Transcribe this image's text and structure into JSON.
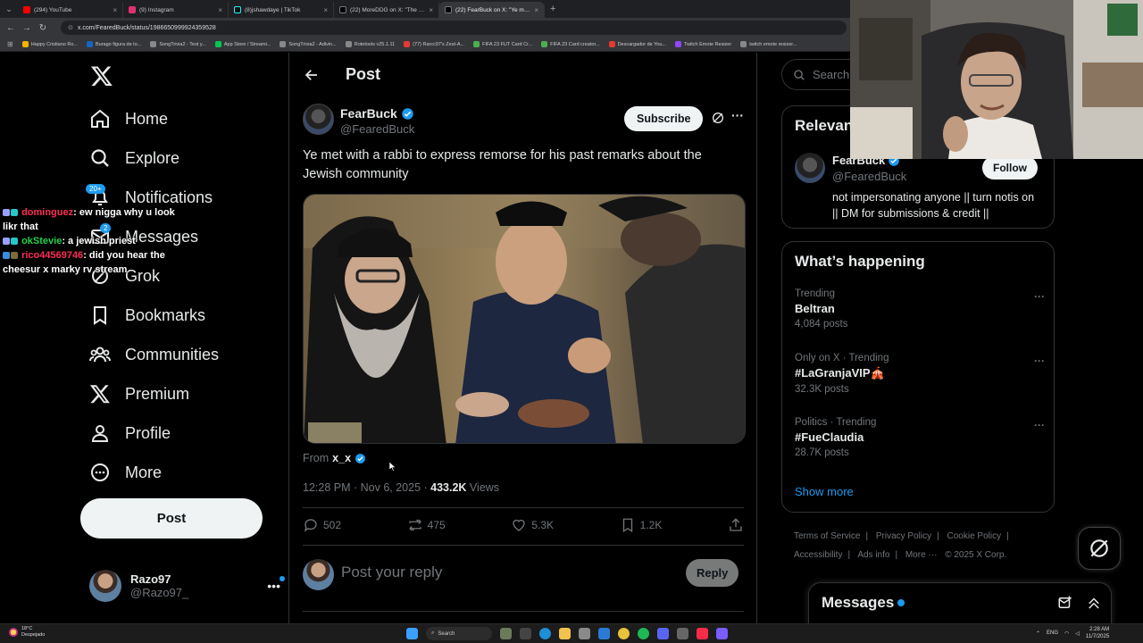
{
  "browser": {
    "tabs": [
      {
        "title": "(294) YouTube",
        "color": "#ff0000",
        "active": false
      },
      {
        "title": "(9) Instagram",
        "color": "#e1306c",
        "active": false
      },
      {
        "title": "(8)jshawdaye | TikTok",
        "color": "#111111",
        "active": false
      },
      {
        "title": "(22) MoreDDG on X: \"The Grizzl...",
        "color": "#000000",
        "active": false
      },
      {
        "title": "(22) FearBuck on X: \"Ye met...",
        "color": "#000000",
        "active": true
      }
    ],
    "url": "x.com/FearedBuck/status/1986650999924359528",
    "bookmarks": [
      {
        "label": "Happy Cristiano Ro...",
        "color": "#f4b400"
      },
      {
        "label": "Burago figura de to...",
        "color": "#1565c0"
      },
      {
        "label": "SongTrivia2 - Test y...",
        "color": "#888888"
      },
      {
        "label": "App Store / Streami...",
        "color": "#00c853"
      },
      {
        "label": "SongTrivia2 - Adivin...",
        "color": "#888888"
      },
      {
        "label": "Rotetools v25.1.11",
        "color": "#888888"
      },
      {
        "label": "(77) Rarcc97's Zest-A...",
        "color": "#e53935"
      },
      {
        "label": "FIFA 23 FUT Card Cr...",
        "color": "#4caf50"
      },
      {
        "label": "FIFA 23 Card creator...",
        "color": "#4caf50"
      },
      {
        "label": "Descargador de You...",
        "color": "#e53935"
      },
      {
        "label": "Twitch Emote Resizer",
        "color": "#9146ff"
      },
      {
        "label": "twitch emote resizer...",
        "color": "#888888"
      }
    ]
  },
  "nav": {
    "items": [
      {
        "label": "Home",
        "icon": "home-icon"
      },
      {
        "label": "Explore",
        "icon": "search-icon"
      },
      {
        "label": "Notifications",
        "icon": "bell-icon",
        "badge": "20+"
      },
      {
        "label": "Messages",
        "icon": "mail-icon",
        "badge": "2"
      },
      {
        "label": "Grok",
        "icon": "grok-icon"
      },
      {
        "label": "Bookmarks",
        "icon": "bookmark-icon"
      },
      {
        "label": "Communities",
        "icon": "communities-icon"
      },
      {
        "label": "Premium",
        "icon": "x-logo-icon"
      },
      {
        "label": "Profile",
        "icon": "user-icon"
      },
      {
        "label": "More",
        "icon": "more-circle-icon"
      }
    ],
    "post_button": "Post",
    "account": {
      "name": "Razo97",
      "handle": "@Razo97_"
    }
  },
  "chat": [
    {
      "user": "dominguez",
      "message": ": ew nigga why u look likr that"
    },
    {
      "user": "okStevie",
      "message": ": a jewish priest"
    },
    {
      "user": "rico44569746",
      "message": ": did you hear the cheesur x marky rv stream"
    }
  ],
  "post": {
    "page_title": "Post",
    "author_name": "FearBuck",
    "author_handle": "@FearedBuck",
    "subscribe_label": "Subscribe",
    "text": "Ye met with a rabbi to express remorse for his past remarks about the Jewish community",
    "from_prefix": "From",
    "from_account": "x_x",
    "time": "12:28 PM · Nov 6, 2025 · ",
    "views_count": "433.2K",
    "views_label": " Views",
    "replies": "502",
    "reposts": "475",
    "likes": "5.3K",
    "bookmarks": "1.2K",
    "reply_placeholder": "Post your reply",
    "reply_button": "Reply"
  },
  "right": {
    "search_placeholder": "Search",
    "relevant_title": "Relevant people",
    "relevant_name": "FearBuck",
    "relevant_handle": "@FearedBuck",
    "follow_label": "Follow",
    "relevant_bio": "not impersonating anyone || turn notis on || DM for submissions & credit ||",
    "happening_title": "What’s happening",
    "trends": [
      {
        "context": "Trending",
        "name": "Beltran",
        "count": "4,084 posts"
      },
      {
        "context": "Only on X · Trending",
        "name": "#LaGranjaVIP🎪",
        "count": "32.3K posts"
      },
      {
        "context": "Politics · Trending",
        "name": "#FueClaudia",
        "count": "28.7K posts"
      }
    ],
    "show_more": "Show more",
    "footer_links": [
      "Terms of Service",
      "|",
      "Privacy Policy",
      "|",
      "Cookie Policy",
      "|",
      "Accessibility",
      "|",
      "Ads info",
      "|",
      "More ···",
      "© 2025 X Corp."
    ],
    "messages_title": "Messages"
  },
  "taskbar": {
    "weather_temp": "18°C",
    "weather_desc": "Despejado",
    "search_label": "Search",
    "lang": "ENG",
    "time": "2:28 AM",
    "date": "11/7/2025"
  },
  "colors": {
    "accent": "#1d9bf0",
    "background": "#000000",
    "text": "#e7e9ea",
    "muted": "#71767b",
    "border": "#2f3336"
  }
}
